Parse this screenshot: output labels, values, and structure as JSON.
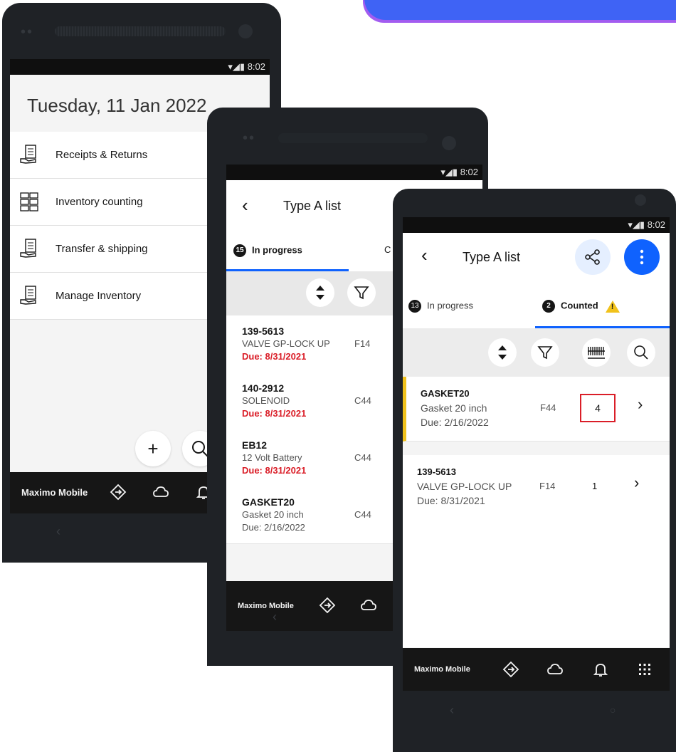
{
  "status_time": "8:02",
  "brand": "Maximo Mobile",
  "home": {
    "date": "Tuesday, 11 Jan 2022",
    "menu": [
      {
        "label": "Receipts & Returns",
        "icon": "receipt-hand-icon"
      },
      {
        "label": "Inventory counting",
        "icon": "inventory-grid-icon"
      },
      {
        "label": "Transfer & shipping",
        "icon": "transfer-hand-icon"
      },
      {
        "label": "Manage Inventory",
        "icon": "manage-hand-icon"
      }
    ],
    "add_symbol": "+",
    "search_symbol": "⚲"
  },
  "list_a": {
    "title": "Type A list",
    "tab_in_progress": {
      "badge": "15",
      "label": "In progress"
    },
    "tab_counted_partial": "C",
    "rows": [
      {
        "code": "139-5613",
        "desc": "VALVE GP-LOCK UP",
        "bin": "F14",
        "due": "Due: 8/31/2021",
        "overdue": true
      },
      {
        "code": "140-2912",
        "desc": "SOLENOID",
        "bin": "C44",
        "due": "Due: 8/31/2021",
        "overdue": true
      },
      {
        "code": "EB12",
        "desc": "12 Volt Battery",
        "bin": "C44",
        "due": "Due: 8/31/2021",
        "overdue": true
      },
      {
        "code": "GASKET20",
        "desc": "Gasket 20 inch",
        "bin": "C44",
        "due": "Due: 2/16/2022",
        "overdue": false
      }
    ]
  },
  "list_b": {
    "title": "Type A list",
    "tab_in_progress": {
      "badge": "13",
      "label": "In progress"
    },
    "tab_counted": {
      "badge": "2",
      "label": "Counted"
    },
    "rows": [
      {
        "code": "GASKET20",
        "desc": "Gasket 20 inch",
        "bin": "F44",
        "due": "Due: 2/16/2022",
        "count": "4"
      },
      {
        "code": "139-5613",
        "desc": "VALVE GP-LOCK UP",
        "bin": "F14",
        "due": "Due: 8/31/2021",
        "count": "1"
      }
    ]
  },
  "colors": {
    "accent": "#0f62fe",
    "error": "#da1e28",
    "warning": "#f1c21b",
    "banner": "#3f63f5",
    "navbar": "#161616"
  }
}
